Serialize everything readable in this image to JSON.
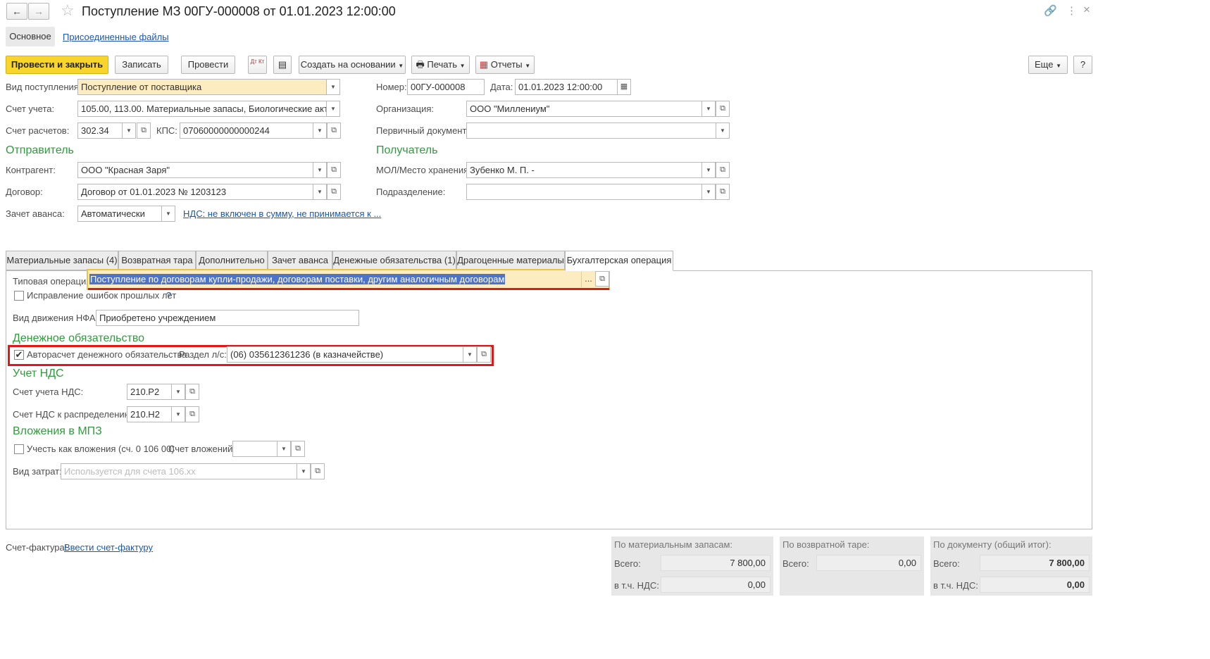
{
  "title": "Поступление МЗ 00ГУ-000008 от 01.01.2023 12:00:00",
  "nav": {
    "main": "Основное",
    "files": "Присоединенные файлы"
  },
  "toolbar": {
    "post_close": "Провести и закрыть",
    "save": "Записать",
    "post": "Провести",
    "dtkt": "Дт Кт",
    "create_based": "Создать на основании",
    "print": "Печать",
    "reports": "Отчеты",
    "more": "Еще",
    "help": "?"
  },
  "header": {
    "vid_label": "Вид поступления:",
    "vid_value": "Поступление от поставщика",
    "schet_label": "Счет учета:",
    "schet_value": "105.00, 113.00. Материальные запасы, Биологические активы",
    "raschet_label": "Счет расчетов:",
    "raschet_value": "302.34",
    "kps_label": "КПС:",
    "kps_value": "07060000000000244",
    "nomer_label": "Номер:",
    "nomer_value": "00ГУ-000008",
    "data_label": "Дата:",
    "data_value": "01.01.2023 12:00:00",
    "org_label": "Организация:",
    "org_value": "ООО \"Миллениум\"",
    "perv_label": "Первичный документ:",
    "perv_value": ""
  },
  "sender": {
    "heading": "Отправитель",
    "kontr_label": "Контрагент:",
    "kontr_value": "ООО \"Красная Заря\"",
    "dogovor_label": "Договор:",
    "dogovor_value": "Договор от 01.01.2023 № 1203123",
    "avans_label": "Зачет аванса:",
    "avans_value": "Автоматически",
    "nds_link": "НДС: не включен в сумму, не принимается к ..."
  },
  "receiver": {
    "heading": "Получатель",
    "mol_label": "МОЛ/Место хранения:",
    "mol_value": "Зубенко М. П. -",
    "podr_label": "Подразделение:",
    "podr_value": ""
  },
  "tabs": [
    "Материальные запасы (4)",
    "Возвратная тара",
    "Дополнительно",
    "Зачет аванса",
    "Денежные обязательства (1)",
    "Драгоценные материалы",
    "Бухгалтерская операция"
  ],
  "op": {
    "tip_label": "Типовая операция:",
    "tip_value": "Поступление по договорам купли-продажи, договорам поставки, другим аналогичным договорам",
    "tip_btn": "...",
    "isprav_label": "Исправление ошибок прошлых лет",
    "isprav_help": "?",
    "nfa_label": "Вид движения НФА:",
    "nfa_value": "Приобретено учреждением",
    "den_heading": "Денежное обязательство",
    "avto_label": "Авторасчет денежного обязательства",
    "razdel_label": "Раздел л/с:",
    "razdel_value": "(06) 035612361236 (в казначействе)",
    "avto_checked": true,
    "nds_heading": "Учет НДС",
    "nds_schet_label": "Счет учета НДС:",
    "nds_schet_value": "210.Р2",
    "nds_rasp_label": "Счет НДС к распределению:",
    "nds_rasp_value": "210.Н2",
    "vl_heading": "Вложения в МПЗ",
    "vl_label": "Учесть как вложения (сч. 0 106 00)",
    "vl_schet_label": "Счет вложений:",
    "vl_schet_value": "",
    "zatr_label": "Вид затрат:",
    "zatr_placeholder": "Используется для счета 106.хх"
  },
  "footer": {
    "sf_label": "Счет-фактура:",
    "sf_link": "Ввести счет-фактуру"
  },
  "totals": [
    {
      "title": "По материальным запасам:",
      "vsego_label": "Всего:",
      "vsego": "7 800,00",
      "nds_label": "в т.ч. НДС:",
      "nds": "0,00"
    },
    {
      "title": "По возвратной таре:",
      "vsego_label": "Всего:",
      "vsego": "0,00"
    },
    {
      "title": "По документу (общий итог):",
      "vsego_label": "Всего:",
      "vsego": "7 800,00",
      "nds_label": "в т.ч. НДС:",
      "nds": "0,00"
    }
  ]
}
